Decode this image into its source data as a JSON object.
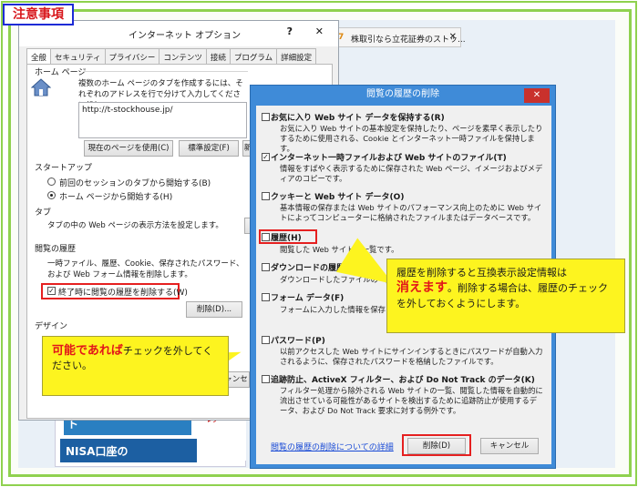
{
  "notice": "注意事項",
  "browser": {
    "tab_title": "株取引なら立花証券のストッ...",
    "tab_icon": "7",
    "ad_nisa_top": "NISA 日証協特設サイト",
    "ad_nisa_bottom": "NISA口座の",
    "ad_right": "仕設 ▸NI ▸ノ"
  },
  "internet_options": {
    "title": "インターネット オプション",
    "help": "?",
    "close": "✕",
    "tabs": [
      "全般",
      "セキュリティ",
      "プライバシー",
      "コンテンツ",
      "接続",
      "プログラム",
      "詳細設定"
    ],
    "home_page_label": "ホーム ページ",
    "home_page_desc": "複数のホーム ページのタブを作成するには、それぞれのアドレスを行で分けて入力してください(R)",
    "home_url": "http://t-stockhouse.jp/",
    "btn_use_current": "現在のページを使用(C)",
    "btn_default": "標準設定(F)",
    "btn_new": "新",
    "startup_label": "スタートアップ",
    "startup_opt1": "前回のセッションのタブから開始する(B)",
    "startup_opt2": "ホーム ページから開始する(H)",
    "tabs_label": "タブ",
    "tabs_desc": "タブの中の Web ページの表示方法を設定します。",
    "history_label": "閲覧の履歴",
    "history_desc": "一時ファイル、履歴、Cookie、保存されたパスワード、および Web フォーム情報を削除します。",
    "history_check": "終了時に閲覧の履歴を削除する(W)",
    "btn_delete": "削除(D)...",
    "design_label": "デザイン",
    "cancel_partial": "ャンセ"
  },
  "callout_left": {
    "highlight": "可能であれば",
    "text": "チェックを外してください。"
  },
  "delete_history": {
    "title": "閲覧の履歴の削除",
    "close": "✕",
    "options": [
      {
        "label": "お気に入り Web サイト データを保持する(R)",
        "checked": false,
        "desc": "お気に入り Web サイトの基本設定を保持したり、ページを素早く表示したりするために使用される、Cookie とインターネット一時ファイルを保持します。"
      },
      {
        "label": "インターネット一時ファイルおよび Web サイトのファイル(T)",
        "checked": true,
        "desc": "情報をすばやく表示するために保存された Web ページ、イメージおよびメディアのコピーです。"
      },
      {
        "label": "クッキーと Web サイト データ(O)",
        "checked": false,
        "desc": "基本情報の保存または Web サイトのパフォーマンス向上のために Web サイトによってコンピューターに格納されたファイルまたはデータベースです。"
      },
      {
        "label": "履歴(H)",
        "checked": false,
        "desc": "閲覧した Web サイトの一覧です。"
      },
      {
        "label": "ダウンロードの履歴(W)",
        "checked": false,
        "desc": "ダウンロードしたファイルの一覧です"
      },
      {
        "label": "フォーム データ(F)",
        "checked": false,
        "desc": "フォームに入力した情報を保存した"
      },
      {
        "label": "パスワード(P)",
        "checked": false,
        "desc": "以前アクセスした Web サイトにサインインするときにパスワードが自動入力されるように、保存されたパスワードを格納したファイルです。"
      },
      {
        "label": "追跡防止、ActiveX フィルター、および Do Not Track のデータ(K)",
        "checked": false,
        "desc": "フィルター処理から除外される Web サイトの一覧、閲覧した情報を自動的に流出させている可能性があるサイトを検出するために追跡防止が使用するデータ、および Do Not Track 要求に対する例外です。"
      }
    ],
    "link": "閲覧の履歴の削除についての詳細",
    "btn_delete": "削除(D)",
    "btn_cancel": "キャンセル"
  },
  "callout_right": {
    "line1": "履歴を削除すると互換表示設定情報は",
    "highlight": "消えます",
    "line2": "。削除する場合は、履歴のチェックを外しておくようにします。"
  }
}
